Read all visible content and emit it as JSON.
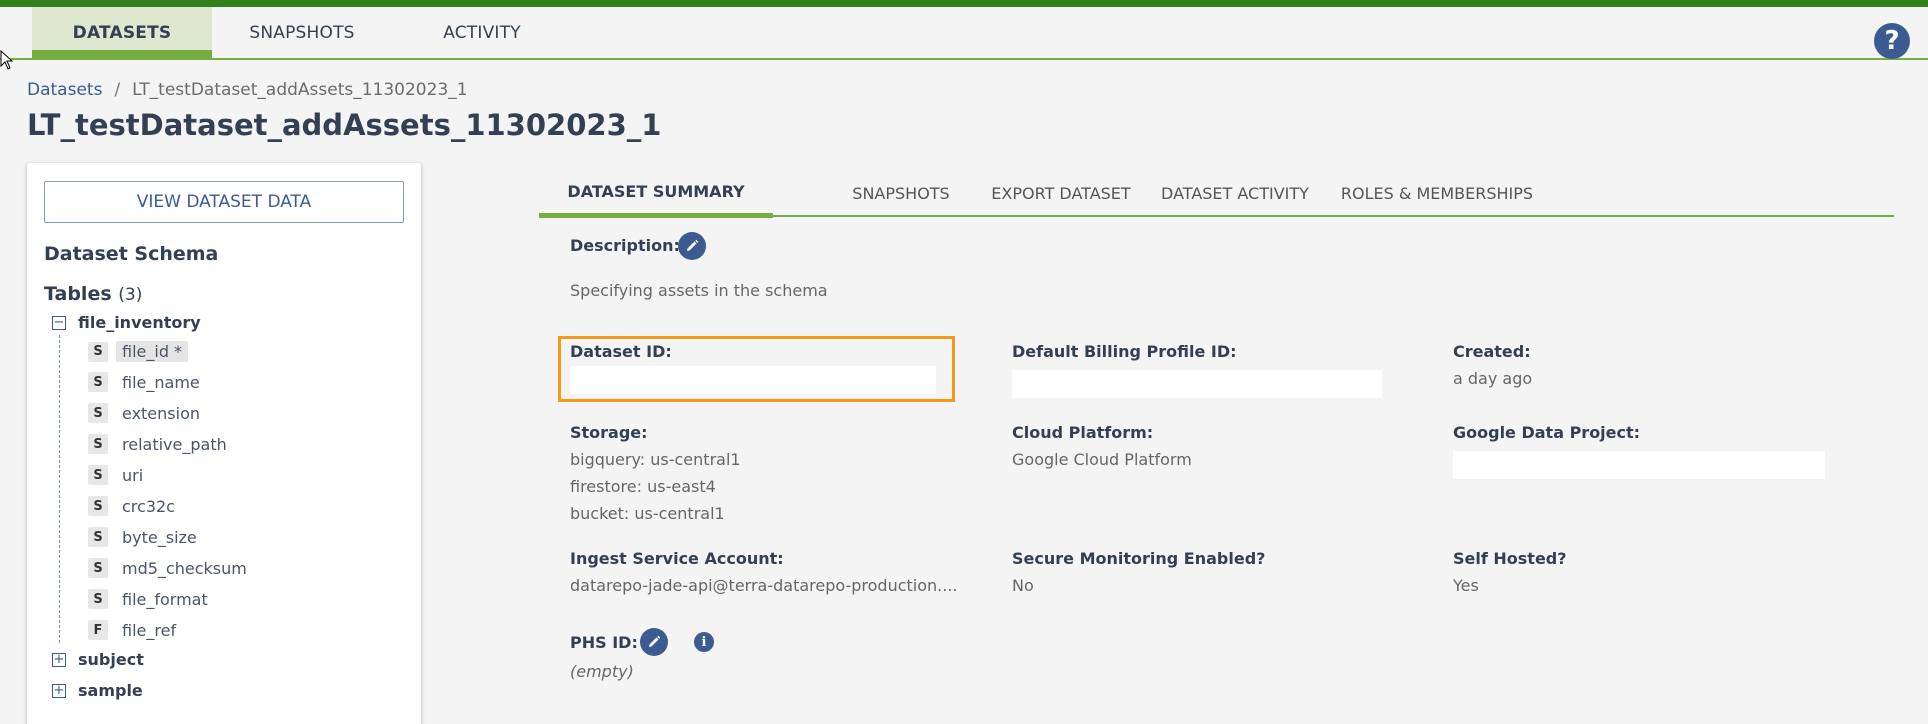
{
  "topnav": {
    "tabs": [
      {
        "label": "DATASETS",
        "active": true
      },
      {
        "label": "SNAPSHOTS",
        "active": false
      },
      {
        "label": "ACTIVITY",
        "active": false
      }
    ],
    "help_icon": "question-icon"
  },
  "breadcrumb": {
    "root": "Datasets",
    "separator": "/",
    "current": "LT_testDataset_addAssets_11302023_1"
  },
  "page_title": "LT_testDataset_addAssets_11302023_1",
  "sidebar": {
    "view_button": "VIEW DATASET DATA",
    "schema_title": "Dataset Schema",
    "tables_label": "Tables",
    "tables_count": "(3)",
    "tables": [
      {
        "name": "file_inventory",
        "expanded": true,
        "columns": [
          {
            "type": "S",
            "name": "file_id *"
          },
          {
            "type": "S",
            "name": "file_name"
          },
          {
            "type": "S",
            "name": "extension"
          },
          {
            "type": "S",
            "name": "relative_path"
          },
          {
            "type": "S",
            "name": "uri"
          },
          {
            "type": "S",
            "name": "crc32c"
          },
          {
            "type": "S",
            "name": "byte_size"
          },
          {
            "type": "S",
            "name": "md5_checksum"
          },
          {
            "type": "S",
            "name": "file_format"
          },
          {
            "type": "F",
            "name": "file_ref"
          }
        ]
      },
      {
        "name": "subject",
        "expanded": false
      },
      {
        "name": "sample",
        "expanded": false
      }
    ],
    "collapse_glyph": "−",
    "expand_glyph": "+"
  },
  "tabs": [
    {
      "label": "DATASET SUMMARY",
      "active": true
    },
    {
      "label": "SNAPSHOTS",
      "active": false
    },
    {
      "label": "EXPORT DATASET",
      "active": false
    },
    {
      "label": "DATASET ACTIVITY",
      "active": false
    },
    {
      "label": "ROLES & MEMBERSHIPS",
      "active": false
    }
  ],
  "summary": {
    "description_label": "Description:",
    "description_value": "Specifying assets in the schema",
    "dataset_id_label": "Dataset ID:",
    "billing_label": "Default Billing Profile ID:",
    "created_label": "Created:",
    "created_value": "a day ago",
    "storage_label": "Storage:",
    "storage_values": [
      "bigquery: us-central1",
      "firestore: us-east4",
      "bucket: us-central1"
    ],
    "cloud_label": "Cloud Platform:",
    "cloud_value": "Google Cloud Platform",
    "google_project_label": "Google Data Project:",
    "ingest_label": "Ingest Service Account:",
    "ingest_value": "datarepo-jade-api@terra-datarepo-production....",
    "secure_label": "Secure Monitoring Enabled?",
    "secure_value": "No",
    "self_hosted_label": "Self Hosted?",
    "self_hosted_value": "Yes",
    "phs_label": "PHS ID:",
    "phs_value": "(empty)",
    "info_glyph": "i"
  },
  "colors": {
    "accent_green": "#74ae43",
    "brand_blue": "#3b5b91",
    "highlight": "#f4991a"
  }
}
